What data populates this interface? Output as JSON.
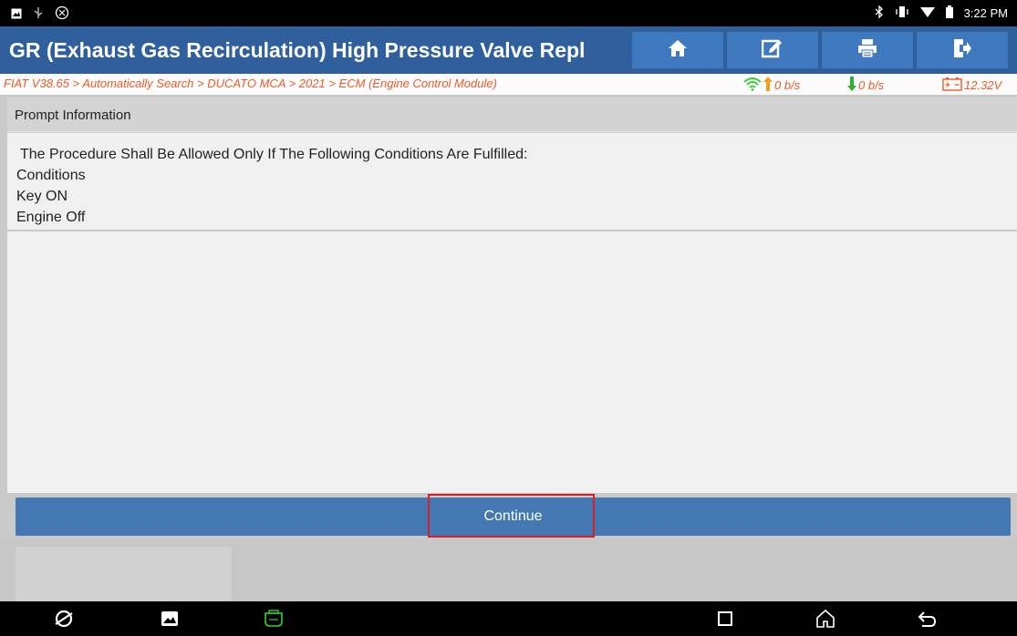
{
  "status_bar": {
    "time": "3:22 PM",
    "left_icons": [
      "image-icon",
      "usb-icon",
      "app-icon"
    ],
    "right_icons": [
      "bluetooth-icon",
      "vibrate-icon",
      "wifi-icon",
      "battery-icon"
    ]
  },
  "header": {
    "title": "GR (Exhaust Gas Recirculation) High Pressure Valve Repl",
    "buttons": [
      "home-icon",
      "edit-icon",
      "print-icon",
      "exit-icon"
    ]
  },
  "breadcrumb": {
    "text": "FIAT V38.65 > Automatically Search > DUCATO MCA > 2021 > ECM (Engine Control Module)",
    "upload_rate": "0 b/s",
    "download_rate": "0 b/s",
    "voltage": "12.32V"
  },
  "panel": {
    "header": "Prompt Information",
    "lines": [
      "The Procedure Shall Be Allowed Only If The Following Conditions Are Fulfilled:",
      "Conditions",
      "Key ON",
      "Engine Off"
    ]
  },
  "actions": {
    "continue_label": "Continue"
  },
  "colors": {
    "title_bar": "#2f5f9c",
    "button": "#4378b3",
    "breadcrumb_text": "#ee5b27",
    "highlight": "#d4202b",
    "signal_green": "#33cc33",
    "upload_arrow": "#f0a020"
  },
  "nav_bar": [
    "browser-icon",
    "gallery-icon",
    "vci-icon",
    "recents-icon",
    "home-icon",
    "back-icon"
  ]
}
